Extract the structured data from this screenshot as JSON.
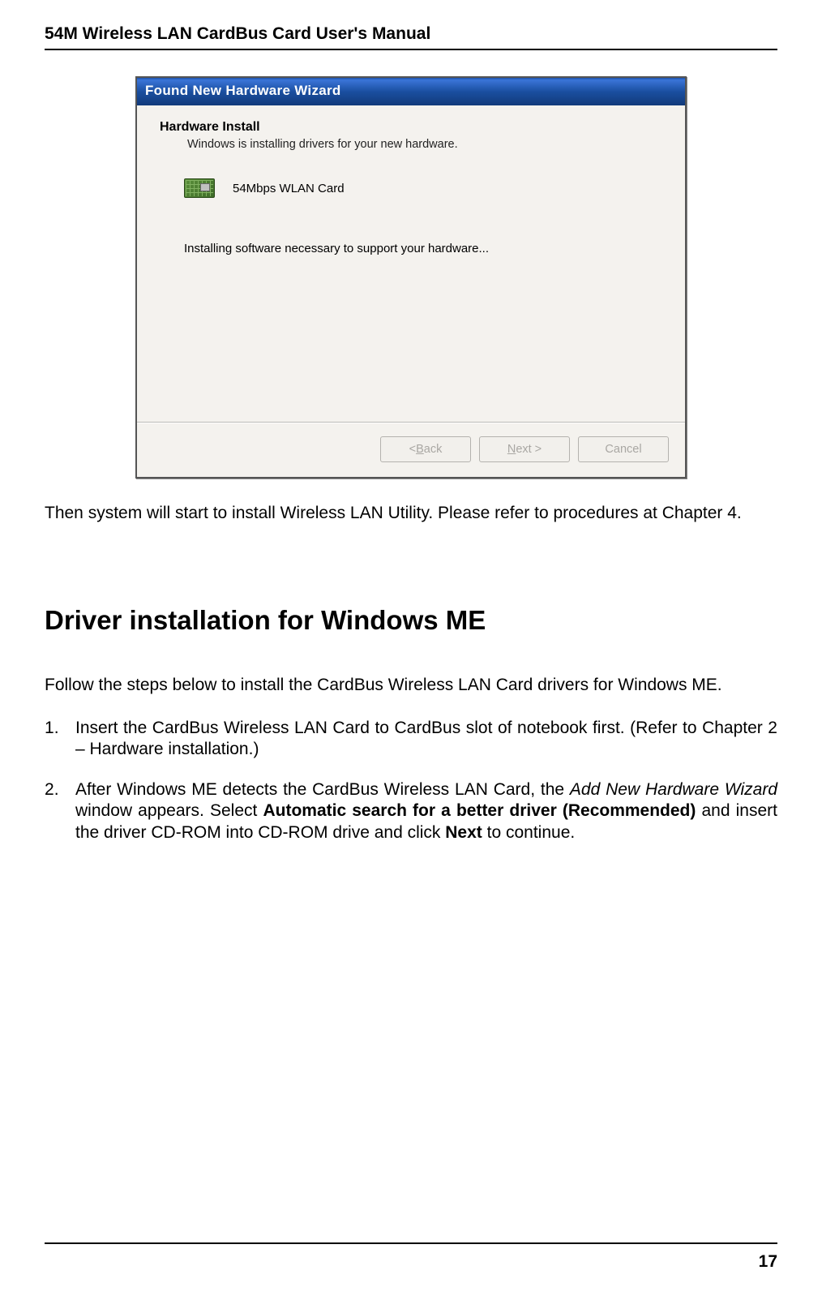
{
  "header": {
    "title": "54M Wireless LAN CardBus Card User's Manual"
  },
  "dialog": {
    "title": "Found New Hardware Wizard",
    "install_heading": "Hardware Install",
    "install_sub": "Windows is installing drivers for your new hardware.",
    "device_name": "54Mbps WLAN Card",
    "install_message": "Installing software necessary to support your hardware...",
    "buttons": {
      "back_prefix": "< ",
      "back_u": "B",
      "back_rest": "ack",
      "next_u": "N",
      "next_rest": "ext >",
      "cancel": "Cancel"
    }
  },
  "body": {
    "after_dialog": "Then system will start to install Wireless LAN Utility. Please refer to procedures at Chapter 4.",
    "section_title": "Driver installation for Windows ME",
    "intro": "Follow the steps below to install the CardBus Wireless LAN Card drivers for Windows ME.",
    "steps": {
      "s1": "Insert the CardBus Wireless LAN Card to CardBus slot of notebook first. (Refer to Chapter 2 – Hardware installation.)",
      "s2_part1": "After Windows ME detects the CardBus Wireless LAN Card, the ",
      "s2_italic": "Add New Hardware Wizard",
      "s2_part2": " window appears. Select ",
      "s2_bold1": "Automatic search for a better driver (Recommended)",
      "s2_part3": " and insert the driver CD-ROM into CD-ROM drive and click ",
      "s2_bold2": "Next",
      "s2_part4": " to continue."
    }
  },
  "footer": {
    "page": "17"
  }
}
